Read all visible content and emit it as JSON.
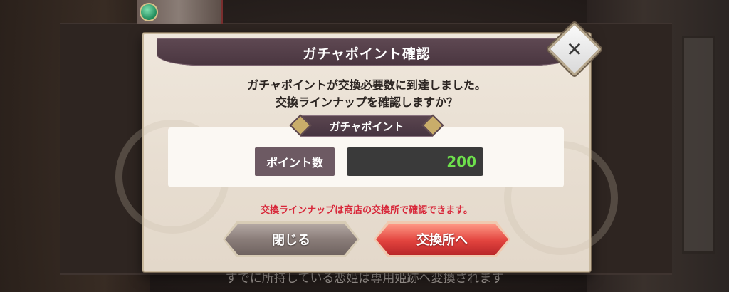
{
  "dialog": {
    "title": "ガチャポイント確認",
    "message_line1": "ガチャポイントが交換必要数に到達しました。",
    "message_line2": "交換ラインナップを確認しますか？",
    "panel_label": "ガチャポイント",
    "points_label": "ポイント数",
    "points_value": "200",
    "note": "交換ラインナップは商店の交換所で確認できます。",
    "close_symbol": "✕",
    "buttons": {
      "close_label": "閉じる",
      "exchange_label": "交換所へ"
    }
  },
  "background": {
    "caption": "すでに所持している恋姫は専用姫跡へ変換されます"
  },
  "colors": {
    "header": "#4a3640",
    "points_value": "#6ee04c",
    "note": "#d8283a",
    "exchange_button": "#e2433e",
    "close_button": "#8a7d79"
  },
  "icons": {
    "close": "close-icon",
    "label_ornament": "diamond-ornament-icon"
  }
}
